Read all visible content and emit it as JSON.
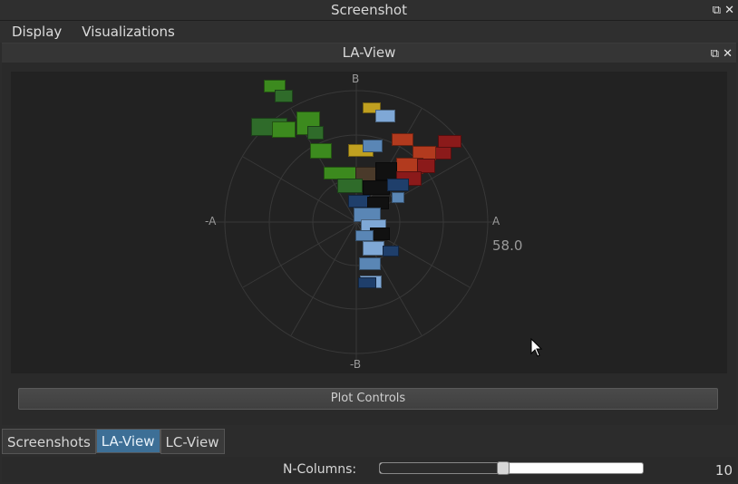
{
  "window": {
    "title": "Screenshot",
    "restore_icon": "⧉",
    "close_icon": "✕"
  },
  "menubar": {
    "items": [
      "Display",
      "Visualizations"
    ]
  },
  "panel": {
    "title": "LA-View",
    "restore_icon": "⧉",
    "close_icon": "✕"
  },
  "plot": {
    "axis_top": "B",
    "axis_bottom": "-B",
    "axis_left": "-A",
    "axis_right": "A",
    "radius_value": "58.0",
    "thumbnail_colors": [
      "#3c8a1e",
      "#c0a020",
      "#b23a1e",
      "#8b1a1a",
      "#1f3f6b",
      "#5a86b5",
      "#2f6b2a",
      "#4a3a2a",
      "#111111",
      "#7fa8d6"
    ]
  },
  "plot_controls": {
    "label": "Plot Controls"
  },
  "tabs": [
    {
      "label": "Screenshots",
      "active": false
    },
    {
      "label": "LA-View",
      "active": true
    },
    {
      "label": "LC-View",
      "active": false
    }
  ],
  "ncolumns": {
    "label": "N-Columns:",
    "value": "10",
    "slider_fraction": 0.47
  }
}
